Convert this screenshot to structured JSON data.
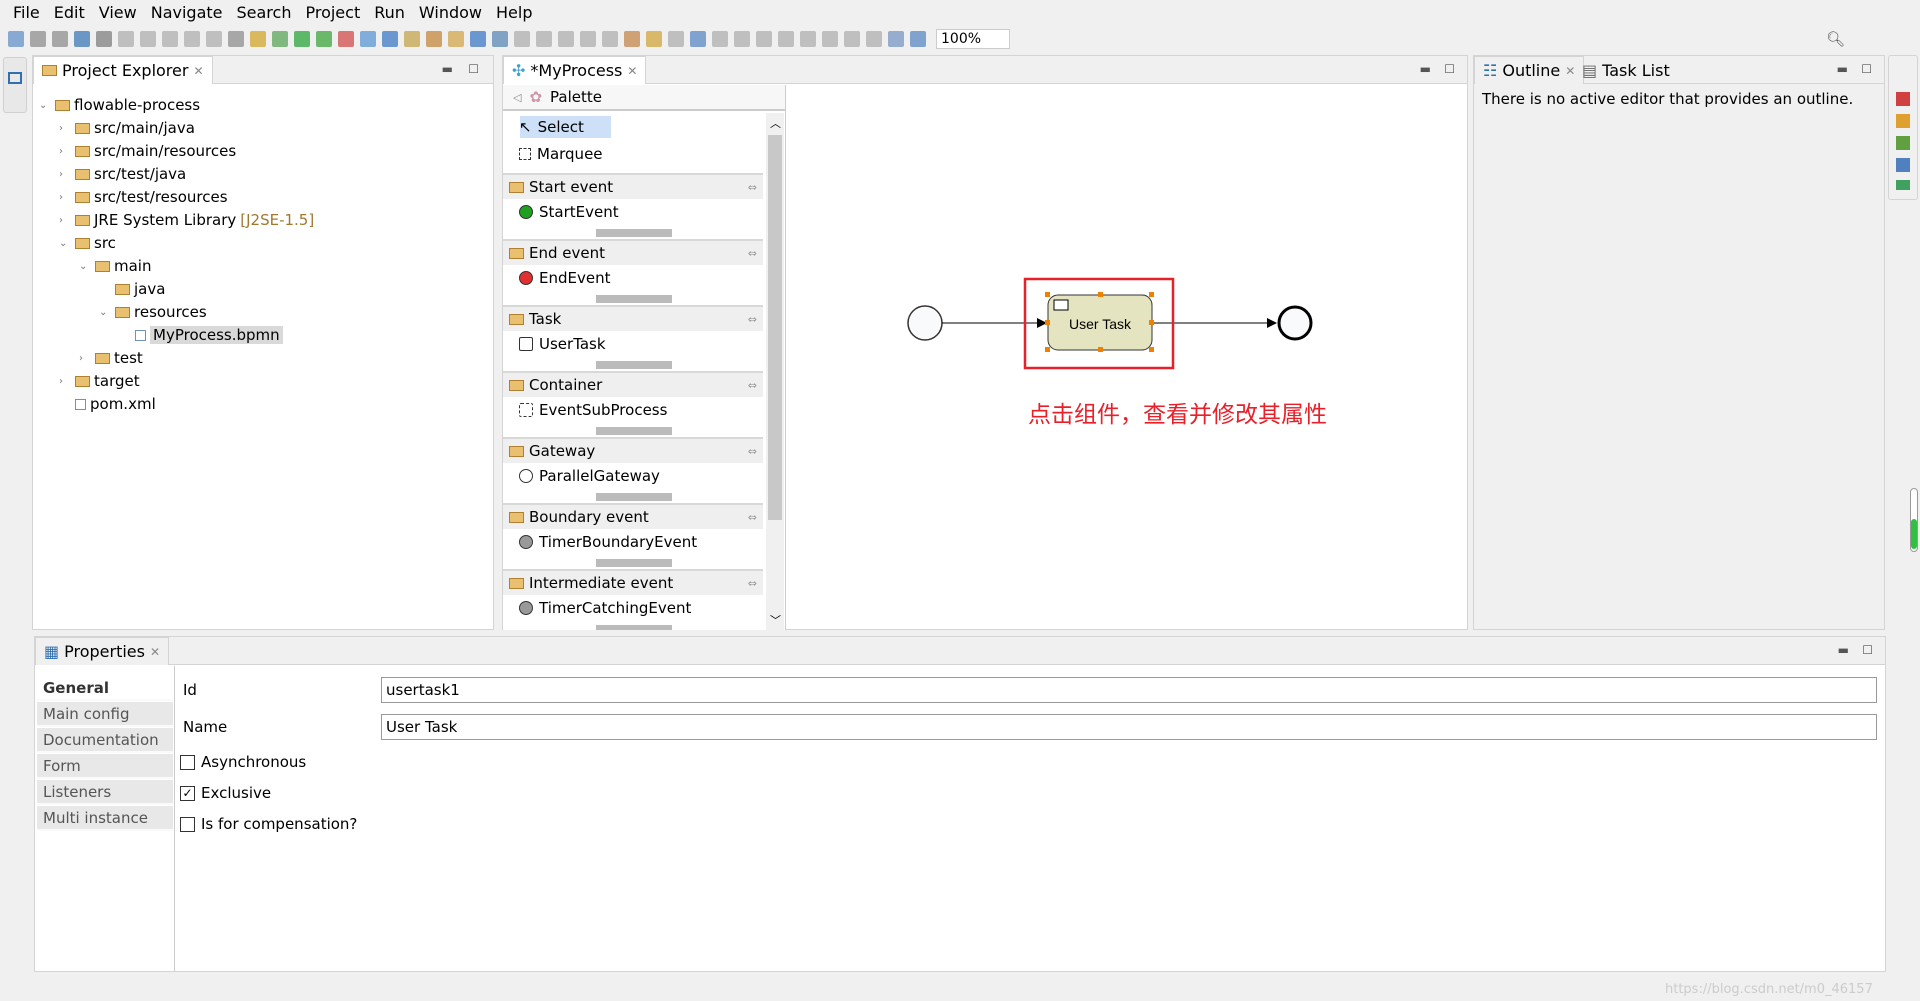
{
  "menu": [
    "File",
    "Edit",
    "View",
    "Navigate",
    "Search",
    "Project",
    "Run",
    "Window",
    "Help"
  ],
  "toolbar": {
    "zoom": "100%"
  },
  "project_explorer": {
    "title": "Project Explorer",
    "items": [
      {
        "label": "flowable-process",
        "indent": 0,
        "expanded": true
      },
      {
        "label": "src/main/java",
        "indent": 1
      },
      {
        "label": "src/main/resources",
        "indent": 1
      },
      {
        "label": "src/test/java",
        "indent": 1
      },
      {
        "label": "src/test/resources",
        "indent": 1
      },
      {
        "label": "JRE System Library",
        "suffix": "[J2SE-1.5]",
        "indent": 1
      },
      {
        "label": "src",
        "indent": 1,
        "expanded": true
      },
      {
        "label": "main",
        "indent": 2,
        "expanded": true
      },
      {
        "label": "java",
        "indent": 3
      },
      {
        "label": "resources",
        "indent": 3,
        "expanded": true
      },
      {
        "label": "MyProcess.bpmn",
        "indent": 4,
        "selected": true
      },
      {
        "label": "test",
        "indent": 2
      },
      {
        "label": "target",
        "indent": 1
      },
      {
        "label": "pom.xml",
        "indent": 1
      }
    ]
  },
  "editor": {
    "tab": "*MyProcess",
    "palette_title": "Palette",
    "tools": [
      "Select",
      "Marquee"
    ],
    "groups": [
      {
        "name": "Start event",
        "item": "StartEvent"
      },
      {
        "name": "End event",
        "item": "EndEvent"
      },
      {
        "name": "Task",
        "item": "UserTask"
      },
      {
        "name": "Container",
        "item": "EventSubProcess"
      },
      {
        "name": "Gateway",
        "item": "ParallelGateway"
      },
      {
        "name": "Boundary event",
        "item": "TimerBoundaryEvent"
      },
      {
        "name": "Intermediate event",
        "item": "TimerCatchingEvent"
      }
    ],
    "task_label": "User Task",
    "annotation": "点击组件，查看并修改其属性",
    "highlight_color": "#e8202a"
  },
  "outline": {
    "tabs": [
      "Outline",
      "Task List"
    ],
    "message": "There is no active editor that provides an outline."
  },
  "properties": {
    "title": "Properties",
    "tabs": [
      "General",
      "Main config",
      "Documentation",
      "Form",
      "Listeners",
      "Multi instance"
    ],
    "id_label": "Id",
    "id_value": "usertask1",
    "name_label": "Name",
    "name_value": "User Task",
    "checkboxes": [
      {
        "label": "Asynchronous",
        "checked": false
      },
      {
        "label": "Exclusive",
        "checked": true
      },
      {
        "label": "Is for compensation?",
        "checked": false
      }
    ]
  },
  "watermark": "https://blog.csdn.net/m0_46157"
}
